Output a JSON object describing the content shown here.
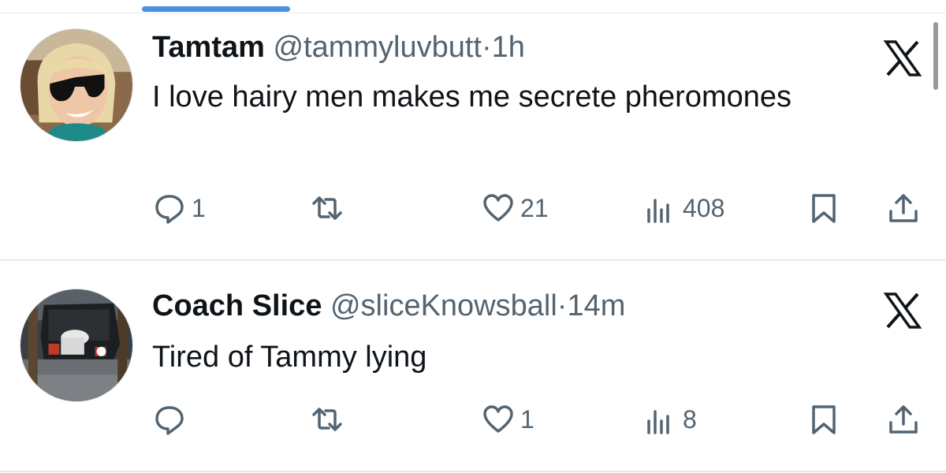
{
  "colors": {
    "accent": "#4a90e2",
    "text_primary": "#0f1419",
    "text_secondary": "#536471",
    "divider": "#e7e9ea"
  },
  "tweets": [
    {
      "display_name": "Tamtam",
      "handle": "@tammyluvbutt",
      "separator": "·",
      "time": "1h",
      "text": "I love hairy men makes me secrete pheromones",
      "avatar": "avatar-woman-sunglasses-icon",
      "actions": {
        "reply_count": "1",
        "retweet_count": "",
        "like_count": "21",
        "view_count": "408"
      }
    },
    {
      "display_name": "Coach Slice",
      "handle": "@sliceKnowsball",
      "separator": "·",
      "time": "14m",
      "text": "Tired of Tammy lying",
      "avatar": "avatar-man-car-trunk-icon",
      "actions": {
        "reply_count": "",
        "retweet_count": "",
        "like_count": "1",
        "view_count": "8"
      }
    }
  ]
}
